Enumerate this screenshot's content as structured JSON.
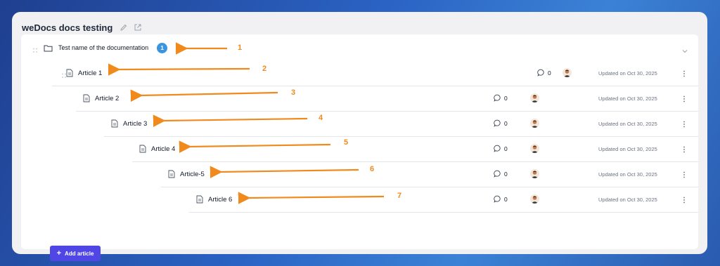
{
  "header": {
    "title": "weDocs docs testing",
    "edit_icon": "pencil-icon",
    "open_icon": "external-link-icon"
  },
  "doc": {
    "name": "Test name of the documentation",
    "count": "1",
    "icon": "folder-icon"
  },
  "articles": [
    {
      "label": "Article 1",
      "comments": "0",
      "updated": "Updated on Oct 30, 2025"
    },
    {
      "label": "Article 2",
      "comments": "0",
      "updated": "Updated on Oct 30, 2025"
    },
    {
      "label": "Article 3",
      "comments": "0",
      "updated": "Updated on Oct 30, 2025"
    },
    {
      "label": "Article 4",
      "comments": "0",
      "updated": "Updated on Oct 30, 2025"
    },
    {
      "label": "Article-5",
      "comments": "0",
      "updated": "Updated on Oct 30, 2025"
    },
    {
      "label": "Article 6",
      "comments": "0",
      "updated": "Updated on Oct 30, 2025"
    }
  ],
  "add_article_label": "Add article",
  "annotations": [
    "1",
    "2",
    "3",
    "4",
    "5",
    "6",
    "7"
  ],
  "colors": {
    "accent": "#4f46e5",
    "badge": "#3b94df",
    "arrow": "#f08a1c"
  }
}
